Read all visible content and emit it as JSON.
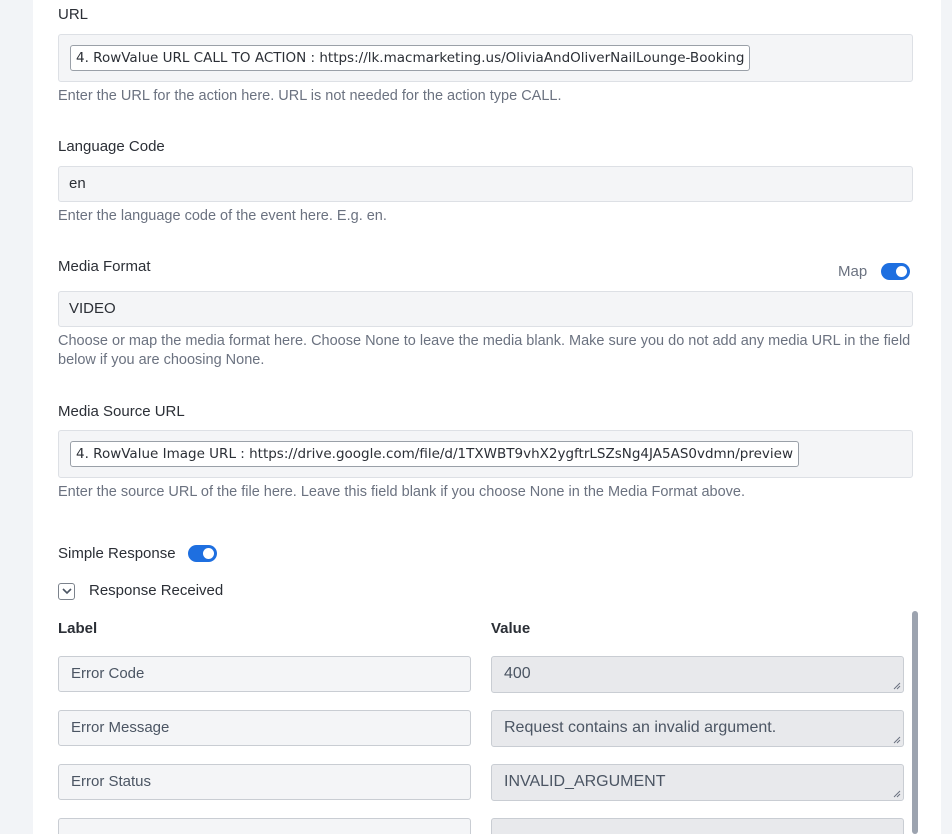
{
  "url_field": {
    "label": "URL",
    "value": "4. RowValue URL CALL TO ACTION : https://lk.macmarketing.us/OliviaAndOliverNailLounge-Booking",
    "help": "Enter the URL for the action here. URL is not needed for the action type CALL."
  },
  "language_field": {
    "label": "Language Code",
    "value": "en",
    "help": "Enter the language code of the event here. E.g. en."
  },
  "media_format_field": {
    "label": "Media Format",
    "map_label": "Map",
    "map_on": true,
    "value": "VIDEO",
    "help": "Choose or map the media format here. Choose None to leave the media blank. Make sure you do not add any media URL in the field below if you are choosing None."
  },
  "media_source_field": {
    "label": "Media Source URL",
    "value": "4. RowValue Image URL : https://drive.google.com/file/d/1TXWBT9vhX2ygftrLSZsNg4JA5AS0vdmn/preview",
    "help": "Enter the source URL of the file here. Leave this field blank if you choose None in the Media Format above."
  },
  "simple_response": {
    "label": "Simple Response",
    "on": true
  },
  "response_received": {
    "label": "Response Received",
    "expanded": true
  },
  "response_table": {
    "label_header": "Label",
    "value_header": "Value",
    "rows": [
      {
        "label": "Error Code",
        "value": "400"
      },
      {
        "label": "Error Message",
        "value": "Request contains an invalid argument."
      },
      {
        "label": "Error Status",
        "value": "INVALID_ARGUMENT"
      }
    ]
  },
  "colors": {
    "accent": "#1e6fe0",
    "help_text": "#6b7280"
  }
}
